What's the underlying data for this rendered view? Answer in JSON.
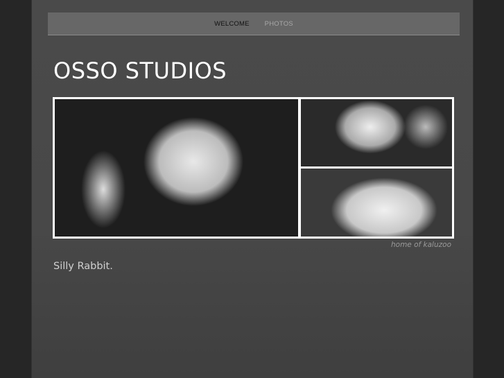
{
  "nav": {
    "items": [
      {
        "label": "WELCOME",
        "active": true
      },
      {
        "label": "PHOTOS",
        "active": false
      }
    ]
  },
  "site_title": "OSSO STUDIOS",
  "banner": {
    "caption": "home of kaluzoo"
  },
  "body_text": "Silly Rabbit."
}
